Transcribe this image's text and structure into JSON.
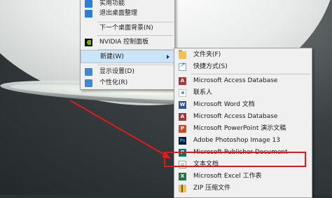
{
  "context_menu": {
    "items": [
      {
        "label": "实用功能",
        "icon": "tools-icon"
      },
      {
        "label": "退出桌面整理",
        "icon": "desktop-organizer-icon"
      },
      {
        "label": "下一个桌面背景(N)",
        "icon": ""
      },
      {
        "label": "NVIDIA 控制面板",
        "icon": "nvidia-icon"
      },
      {
        "label": "新建(W)",
        "icon": "",
        "submenu": true,
        "highlighted": true
      },
      {
        "label": "显示设置(D)",
        "icon": "display-icon"
      },
      {
        "label": "个性化(R)",
        "icon": "personalize-icon"
      }
    ]
  },
  "new_submenu": {
    "items": [
      {
        "label": "文件夹(F)",
        "icon": "folder-icon"
      },
      {
        "label": "快捷方式(S)",
        "icon": "shortcut-icon"
      },
      {
        "label": "Microsoft Access Database",
        "icon": "access-icon"
      },
      {
        "label": "联系人",
        "icon": "contact-icon"
      },
      {
        "label": "Microsoft Word 文档",
        "icon": "word-icon"
      },
      {
        "label": "Microsoft Access Database",
        "icon": "access-icon"
      },
      {
        "label": "Microsoft PowerPoint 演示文稿",
        "icon": "powerpoint-icon"
      },
      {
        "label": "Adobe Photoshop Image 13",
        "icon": "photoshop-icon"
      },
      {
        "label": "Microsoft Publisher Document",
        "icon": "publisher-icon"
      },
      {
        "label": "文本文档",
        "icon": "text-document-icon",
        "annotated": true
      },
      {
        "label": "Microsoft Excel 工作表",
        "icon": "excel-icon"
      },
      {
        "label": "ZIP 压缩文件",
        "icon": "zip-icon"
      }
    ]
  },
  "annotation": {
    "color": "#e0191b"
  }
}
